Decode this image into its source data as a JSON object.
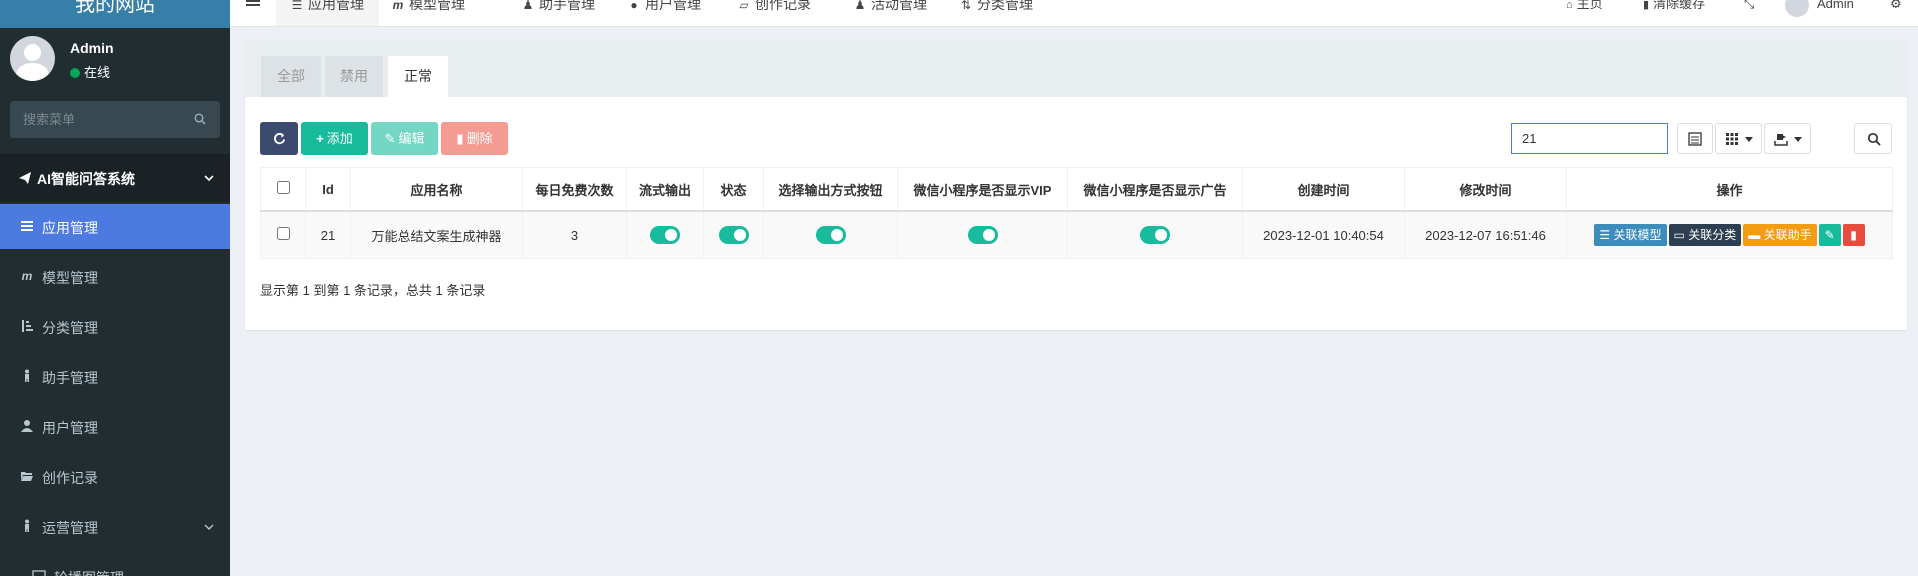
{
  "sidebar": {
    "logo": "我的网站",
    "user": {
      "name": "Admin",
      "status": "在线"
    },
    "search_placeholder": "搜索菜单",
    "menu_header": "AI智能问答系统",
    "items": [
      {
        "label": "应用管理",
        "icon": "list-icon",
        "active": true
      },
      {
        "label": "模型管理",
        "icon": "m-icon"
      },
      {
        "label": "分类管理",
        "icon": "sort-icon"
      },
      {
        "label": "助手管理",
        "icon": "person-icon"
      },
      {
        "label": "用户管理",
        "icon": "user-icon"
      },
      {
        "label": "创作记录",
        "icon": "folder-open-icon"
      },
      {
        "label": "运营管理",
        "icon": "person-icon"
      },
      {
        "label": "轮播图管理",
        "icon": "image-icon"
      }
    ]
  },
  "topbar": {
    "tabs": [
      {
        "label": "应用管理",
        "icon": "list-icon",
        "active": true
      },
      {
        "label": "模型管理",
        "icon": "m-icon"
      },
      {
        "label": "助手管理",
        "icon": "person-icon"
      },
      {
        "label": "用户管理",
        "icon": "user-icon"
      },
      {
        "label": "创作记录",
        "icon": "folder-open-icon"
      },
      {
        "label": "活动管理",
        "icon": "person-icon"
      },
      {
        "label": "分类管理",
        "icon": "sort-icon"
      }
    ],
    "home": "主页",
    "clear_cache": "清除缓存",
    "admin": "Admin"
  },
  "filter_tabs": [
    {
      "label": "全部"
    },
    {
      "label": "禁用"
    },
    {
      "label": "正常",
      "active": true
    }
  ],
  "toolbar": {
    "add": "添加",
    "edit": "编辑",
    "delete": "删除",
    "search_value": "21"
  },
  "table": {
    "headers": [
      "Id",
      "应用名称",
      "每日免费次数",
      "流式输出",
      "状态",
      "选择输出方式按钮",
      "微信小程序是否显示VIP",
      "微信小程序是否显示广告",
      "创建时间",
      "修改时间",
      "操作"
    ],
    "rows": [
      {
        "id": "21",
        "name": "万能总结文案生成神器",
        "free_times": "3",
        "stream": true,
        "status": true,
        "output_btn": true,
        "show_vip": true,
        "show_ad": true,
        "created": "2023-12-01 10:40:54",
        "updated": "2023-12-07 16:51:46"
      }
    ],
    "ops": {
      "model": "关联模型",
      "category": "关联分类",
      "assistant": "关联助手"
    }
  },
  "pagination_info": "显示第 1 到第 1 条记录，总共 1 条记录",
  "colors": {
    "sidebar_bg": "#222d32",
    "active_blue": "#4c7ae0",
    "success": "#18bc9c",
    "primary": "#2c3e50"
  }
}
